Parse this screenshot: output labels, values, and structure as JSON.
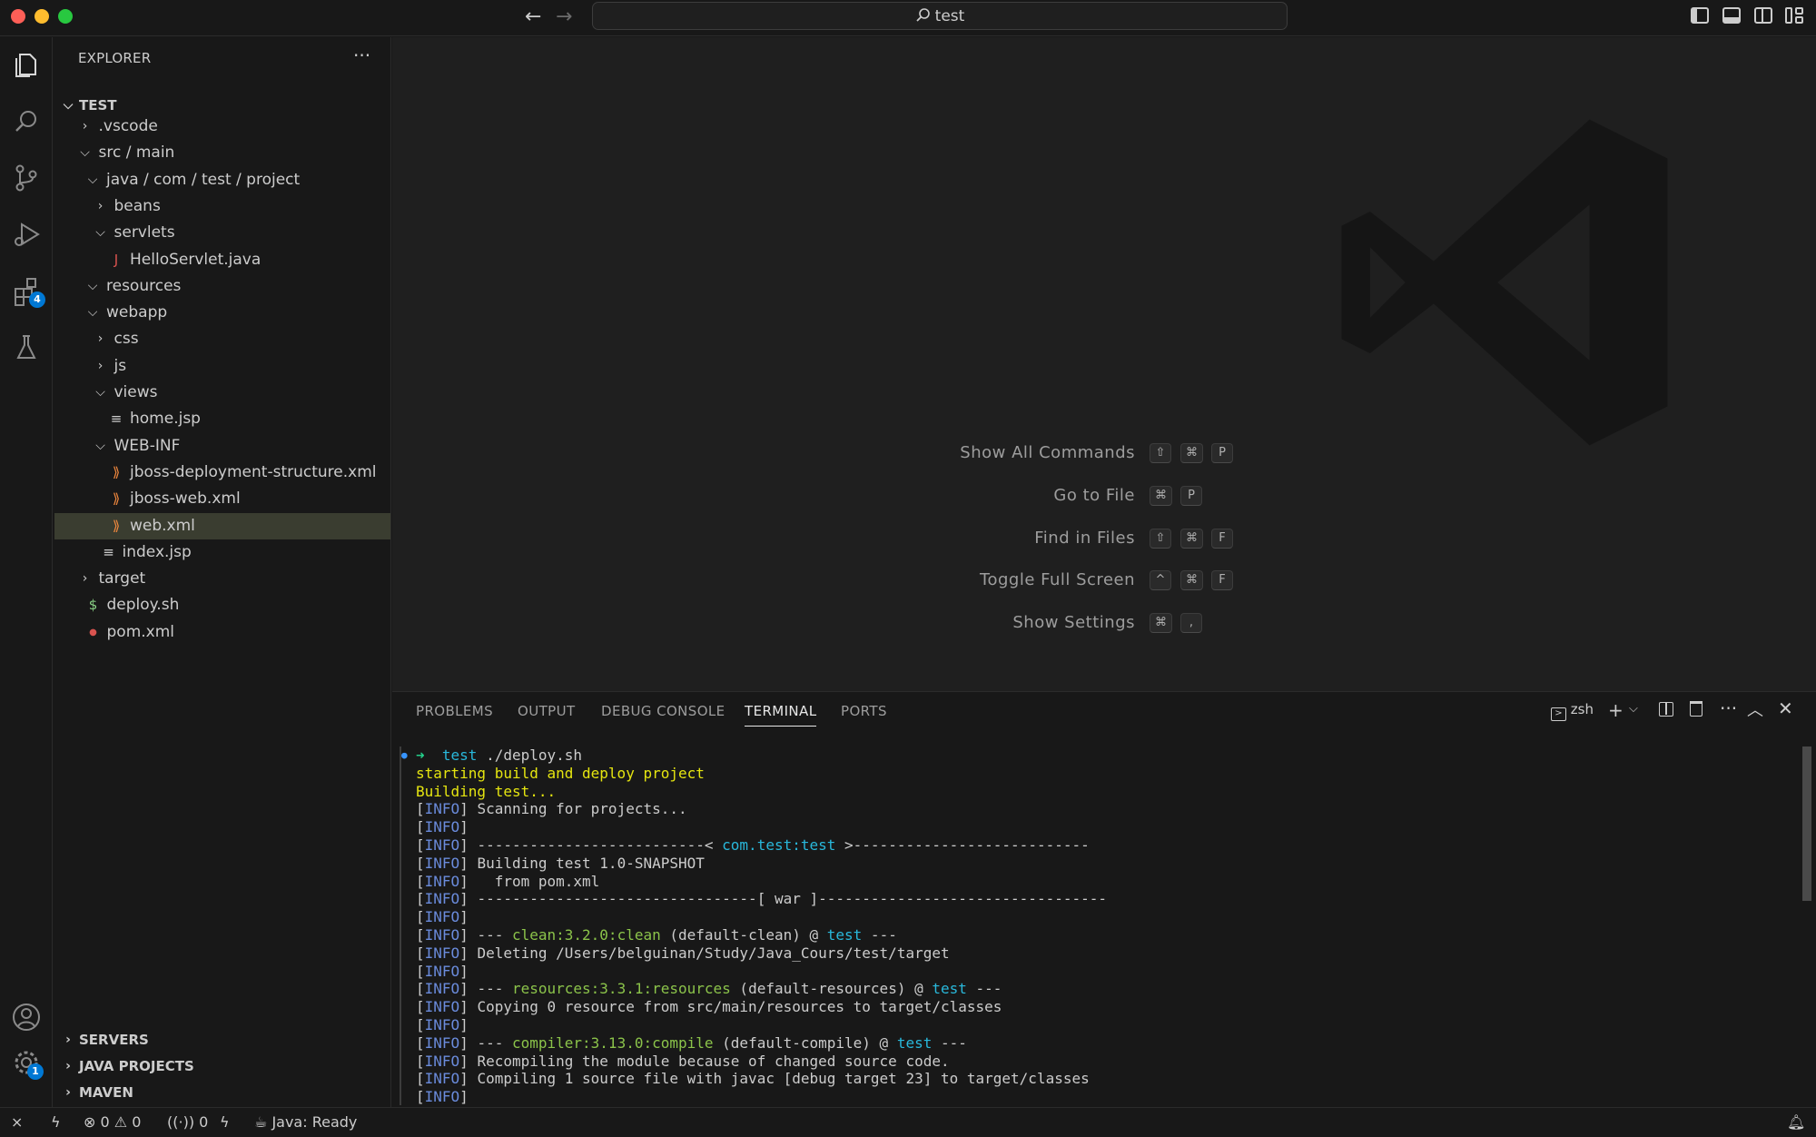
{
  "titlebar": {
    "search_text": "test",
    "back_icon": "arrow-left-icon",
    "forward_icon": "arrow-right-icon"
  },
  "activitybar": {
    "extensions_badge": "4",
    "settings_badge": "1"
  },
  "sidebar": {
    "title": "EXPLORER",
    "more": "···",
    "root": "TEST",
    "items": [
      {
        "label": ".vscode",
        "type": "folder",
        "expanded": false
      },
      {
        "label": "src / main",
        "type": "folder",
        "expanded": true
      },
      {
        "label": "java / com / test / project",
        "type": "folder",
        "expanded": true
      },
      {
        "label": "beans",
        "type": "folder",
        "expanded": false
      },
      {
        "label": "servlets",
        "type": "folder",
        "expanded": true
      },
      {
        "label": "HelloServlet.java",
        "type": "java"
      },
      {
        "label": "resources",
        "type": "folder",
        "expanded": true
      },
      {
        "label": "webapp",
        "type": "folder",
        "expanded": true
      },
      {
        "label": "css",
        "type": "folder",
        "expanded": false
      },
      {
        "label": "js",
        "type": "folder",
        "expanded": false
      },
      {
        "label": "views",
        "type": "folder",
        "expanded": true
      },
      {
        "label": "home.jsp",
        "type": "text"
      },
      {
        "label": "WEB-INF",
        "type": "folder",
        "expanded": true
      },
      {
        "label": "jboss-deployment-structure.xml",
        "type": "xml"
      },
      {
        "label": "jboss-web.xml",
        "type": "xml"
      },
      {
        "label": "web.xml",
        "type": "xml",
        "selected": true
      },
      {
        "label": "index.jsp",
        "type": "text"
      },
      {
        "label": "target",
        "type": "folder",
        "expanded": false
      },
      {
        "label": "deploy.sh",
        "type": "shell"
      },
      {
        "label": "pom.xml",
        "type": "maven"
      }
    ],
    "sections": [
      "SERVERS",
      "JAVA PROJECTS",
      "MAVEN"
    ]
  },
  "editor": {
    "shortcuts": [
      {
        "label": "Show All Commands",
        "keys": [
          "⇧",
          "⌘",
          "P"
        ]
      },
      {
        "label": "Go to File",
        "keys": [
          "⌘",
          "P"
        ]
      },
      {
        "label": "Find in Files",
        "keys": [
          "⇧",
          "⌘",
          "F"
        ]
      },
      {
        "label": "Toggle Full Screen",
        "keys": [
          "^",
          "⌘",
          "F"
        ]
      },
      {
        "label": "Show Settings",
        "keys": [
          "⌘",
          ","
        ]
      }
    ]
  },
  "panel": {
    "tabs": [
      "PROBLEMS",
      "OUTPUT",
      "DEBUG CONSOLE",
      "TERMINAL",
      "PORTS"
    ],
    "active_tab": "TERMINAL",
    "shell": "zsh",
    "terminal": {
      "prompt_arrow": "➜",
      "prompt_dir": "test",
      "command": " ./deploy.sh",
      "lines": [
        {
          "kind": "yellow",
          "text": "starting build and deploy project"
        },
        {
          "kind": "yellow",
          "text": "Building test..."
        },
        {
          "kind": "info",
          "pre": "Scanning for projects...",
          "hl": "",
          "post": ""
        },
        {
          "kind": "info",
          "pre": "",
          "hl": "",
          "post": ""
        },
        {
          "kind": "info",
          "pre": "--------------------------< ",
          "hl": "com.test:test",
          "hlclass": "t-cyan",
          "post": " >---------------------------"
        },
        {
          "kind": "info",
          "pre": "Building test 1.0-SNAPSHOT",
          "hl": "",
          "post": ""
        },
        {
          "kind": "info",
          "pre": "  from pom.xml",
          "hl": "",
          "post": ""
        },
        {
          "kind": "info",
          "pre": "--------------------------------[ war ]---------------------------------",
          "hl": "",
          "post": ""
        },
        {
          "kind": "info",
          "pre": "",
          "hl": "",
          "post": ""
        },
        {
          "kind": "info",
          "pre": "--- ",
          "hl": "clean:3.2.0:clean",
          "hlclass": "t-green",
          "post": " (default-clean) @ ",
          "hl2": "test",
          "post2": " ---"
        },
        {
          "kind": "info",
          "pre": "Deleting /Users/belguinan/Study/Java_Cours/test/target",
          "hl": "",
          "post": ""
        },
        {
          "kind": "info",
          "pre": "",
          "hl": "",
          "post": ""
        },
        {
          "kind": "info",
          "pre": "--- ",
          "hl": "resources:3.3.1:resources",
          "hlclass": "t-green",
          "post": " (default-resources) @ ",
          "hl2": "test",
          "post2": " ---"
        },
        {
          "kind": "info",
          "pre": "Copying 0 resource from src/main/resources to target/classes",
          "hl": "",
          "post": ""
        },
        {
          "kind": "info",
          "pre": "",
          "hl": "",
          "post": ""
        },
        {
          "kind": "info",
          "pre": "--- ",
          "hl": "compiler:3.13.0:compile",
          "hlclass": "t-green",
          "post": " (default-compile) @ ",
          "hl2": "test",
          "post2": " ---"
        },
        {
          "kind": "info",
          "pre": "Recompiling the module because of changed source code.",
          "hl": "",
          "post": ""
        },
        {
          "kind": "info",
          "pre": "Compiling 1 source file with javac [debug target 23] to target/classes",
          "hl": "",
          "post": ""
        },
        {
          "kind": "info",
          "pre": "",
          "hl": "",
          "post": ""
        }
      ],
      "info_tag": "INFO"
    }
  },
  "statusbar": {
    "errors": "0",
    "warnings": "0",
    "ports": "0",
    "java_status": "Java: Ready"
  }
}
